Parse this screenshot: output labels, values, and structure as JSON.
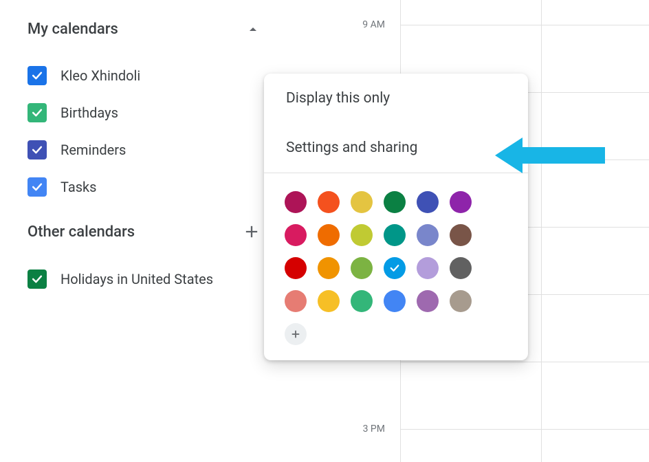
{
  "sidebar": {
    "myCalendars": {
      "title": "My calendars",
      "items": [
        {
          "label": "Kleo Xhindoli",
          "color": "#1a73e8"
        },
        {
          "label": "Birthdays",
          "color": "#33b679"
        },
        {
          "label": "Reminders",
          "color": "#3f51b5"
        },
        {
          "label": "Tasks",
          "color": "#4285f4"
        }
      ]
    },
    "otherCalendars": {
      "title": "Other calendars",
      "items": [
        {
          "label": "Holidays in United States",
          "color": "#0b8043"
        }
      ]
    }
  },
  "popup": {
    "displayOnly": "Display this only",
    "settingsSharing": "Settings and sharing",
    "colors": [
      [
        {
          "hex": "#ad1457",
          "selected": false
        },
        {
          "hex": "#f4511e",
          "selected": false
        },
        {
          "hex": "#e4c441",
          "selected": false
        },
        {
          "hex": "#0b8043",
          "selected": false
        },
        {
          "hex": "#3f51b5",
          "selected": false
        },
        {
          "hex": "#8e24aa",
          "selected": false
        }
      ],
      [
        {
          "hex": "#d81b60",
          "selected": false
        },
        {
          "hex": "#ef6c00",
          "selected": false
        },
        {
          "hex": "#c0ca33",
          "selected": false
        },
        {
          "hex": "#009688",
          "selected": false
        },
        {
          "hex": "#7986cb",
          "selected": false
        },
        {
          "hex": "#795548",
          "selected": false
        }
      ],
      [
        {
          "hex": "#d50000",
          "selected": false
        },
        {
          "hex": "#f09300",
          "selected": false
        },
        {
          "hex": "#7cb342",
          "selected": false
        },
        {
          "hex": "#039be5",
          "selected": true
        },
        {
          "hex": "#b39ddb",
          "selected": false
        },
        {
          "hex": "#616161",
          "selected": false
        }
      ],
      [
        {
          "hex": "#e67c73",
          "selected": false
        },
        {
          "hex": "#f6bf26",
          "selected": false
        },
        {
          "hex": "#33b679",
          "selected": false
        },
        {
          "hex": "#4285f4",
          "selected": false
        },
        {
          "hex": "#9e69af",
          "selected": false
        },
        {
          "hex": "#a79b8e",
          "selected": false
        }
      ]
    ]
  },
  "times": {
    "t9": "9 AM",
    "t15": "3 PM"
  },
  "annotation": {
    "arrow_color": "#18b5e6"
  }
}
